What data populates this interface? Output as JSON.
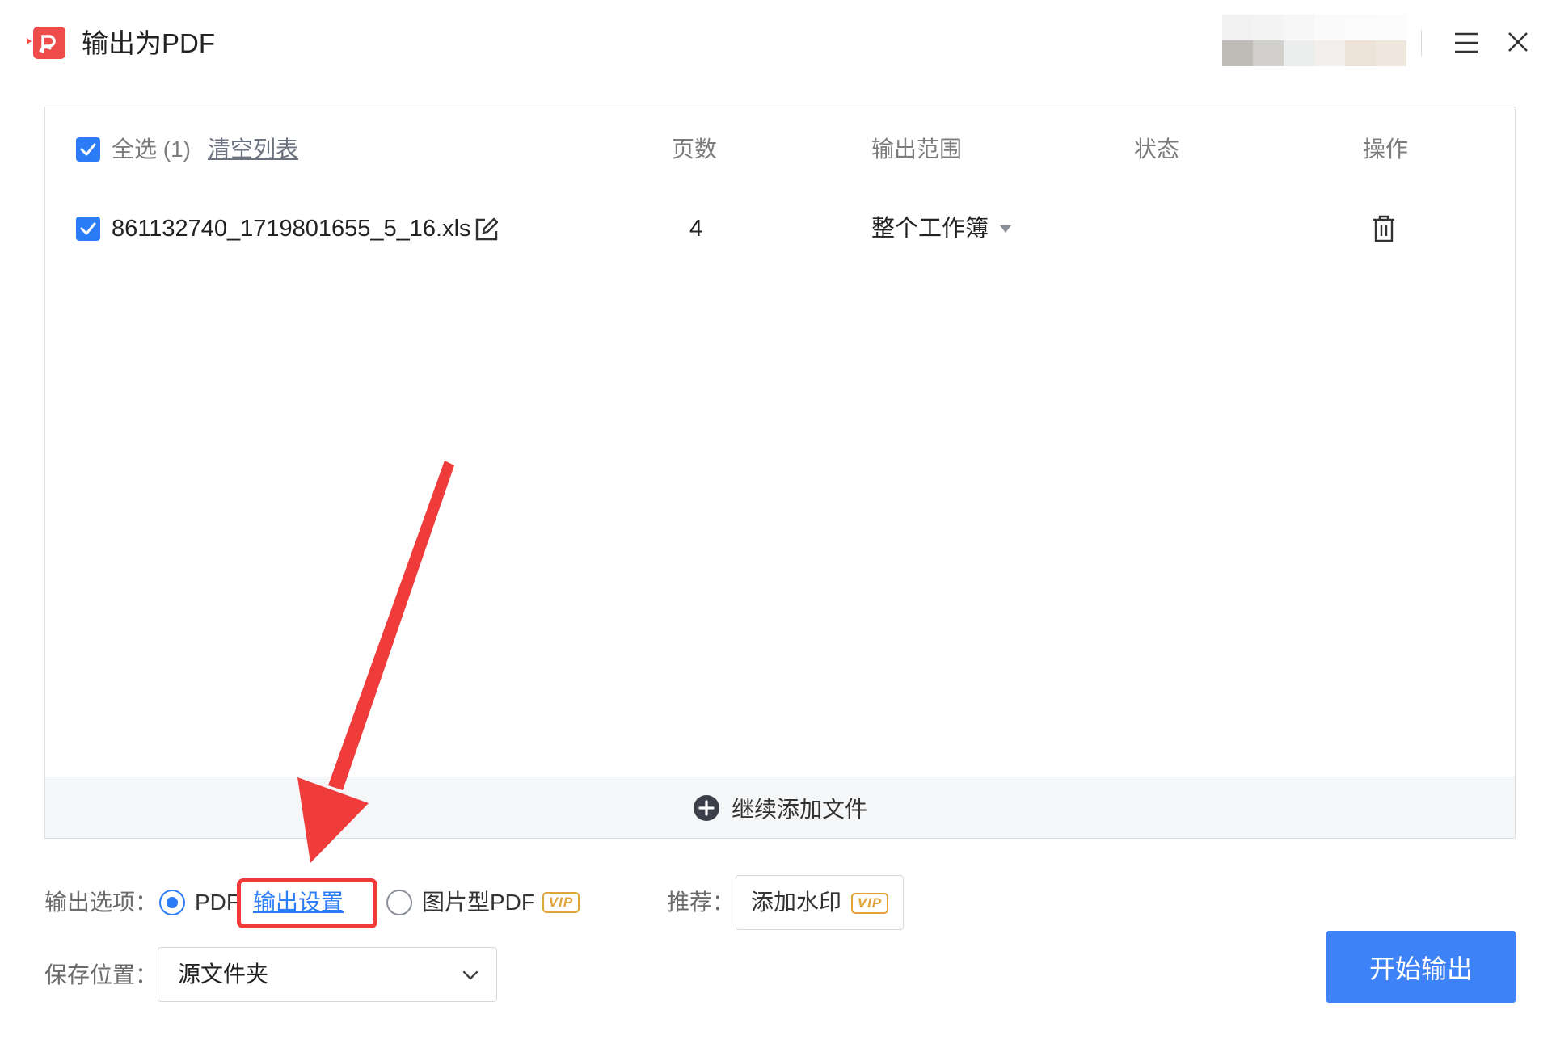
{
  "window": {
    "title": "输出为PDF",
    "icons": {
      "logo": "pdf-app-logo",
      "menu": "hamburger-menu-icon",
      "close": "close-icon"
    }
  },
  "file_list": {
    "header": {
      "select_all": "全选 (1)",
      "select_all_checked": true,
      "clear_list": "清空列表",
      "pages": "页数",
      "range": "输出范围",
      "status": "状态",
      "actions": "操作"
    },
    "rows": [
      {
        "checked": true,
        "file_name": "861132740_1719801655_5_16.xls",
        "pages": "4",
        "range": "整个工作簿",
        "status": ""
      }
    ],
    "add_more": "继续添加文件"
  },
  "options": {
    "output_label": "输出选项：",
    "pdf_label": "PDF",
    "pdf_selected": true,
    "output_settings": "输出设置",
    "image_pdf_label": "图片型PDF",
    "image_pdf_selected": false,
    "vip_badge": "VIP",
    "recommend_label": "推荐：",
    "add_watermark": "添加水印",
    "save_label": "保存位置：",
    "save_value": "源文件夹",
    "start_button": "开始输出"
  },
  "colors": {
    "accent": "#2b7cf6",
    "start_button": "#3d82f7",
    "highlight": "#f03b3b",
    "vip": "#e0a43a",
    "logo": "#ee4b4b"
  }
}
